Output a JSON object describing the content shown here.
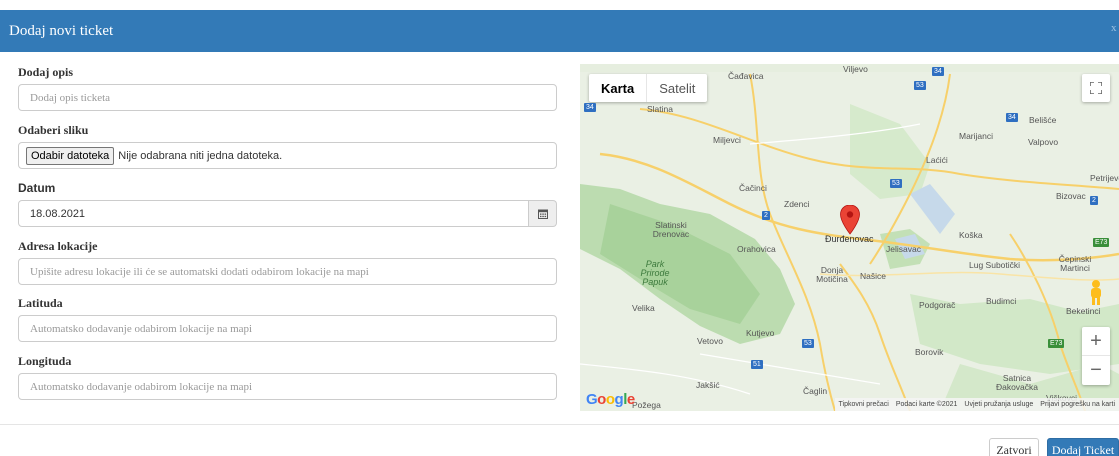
{
  "modal": {
    "title": "Dodaj novi ticket",
    "close_label": "x"
  },
  "form": {
    "description": {
      "label": "Dodaj opis",
      "placeholder": "Dodaj opis ticketa"
    },
    "image": {
      "label": "Odaberi sliku",
      "button_label": "Odabir datoteka",
      "status": "Nije odabrana niti jedna datoteka."
    },
    "date": {
      "label": "Datum",
      "value": "18.08.2021",
      "icon": "calendar-icon"
    },
    "address": {
      "label": "Adresa lokacije",
      "placeholder": "Upišite adresu lokacije ili će se automatski dodati odabirom lokacije na mapi"
    },
    "latitude": {
      "label": "Latituda",
      "placeholder": "Automatsko dodavanje odabirom lokacije na mapi"
    },
    "longitude": {
      "label": "Longituda",
      "placeholder": "Automatsko dodavanje odabirom lokacije na mapi"
    }
  },
  "map": {
    "type_tabs": [
      {
        "label": "Karta",
        "active": true
      },
      {
        "label": "Satelit",
        "active": false
      }
    ],
    "places": [
      "Čađavica",
      "Viljevo",
      "Slatina",
      "Miljevci",
      "Belišće",
      "Marijanci",
      "Valpovo",
      "Laćići",
      "Petrijevci",
      "Bizovac",
      "Čačinci",
      "Zdenci",
      "Slatinski Drenovac",
      "Đurđenovac",
      "Koška",
      "Jelisavac",
      "Orahovica",
      "Park Prirode Papuk",
      "Donja Motičina",
      "Našice",
      "Lug Subotički",
      "Čepinski Martinci",
      "Velika",
      "Podgorač",
      "Budimci",
      "Beketinci",
      "Kutjevo",
      "Vetovo",
      "Borovik",
      "Jakšić",
      "Čaglin",
      "Satnica Đakovačka",
      "Viškovci",
      "Požega"
    ],
    "road_shields": [
      "34",
      "34",
      "53",
      "34",
      "53",
      "2",
      "2",
      "E73",
      "53",
      "51",
      "E73"
    ],
    "logo": "Google",
    "attribution": [
      "Tipkovni prečaci",
      "Podaci karte ©2021",
      "Uvjeti pružanja usluge",
      "Prijavi pogrešku na karti"
    ],
    "zoom_in": "+",
    "zoom_out": "−"
  },
  "footer": {
    "close_button": "Zatvori",
    "submit_button": "Dodaj Ticket"
  },
  "colors": {
    "primary": "#337ab7",
    "marker": "#ea4335"
  }
}
